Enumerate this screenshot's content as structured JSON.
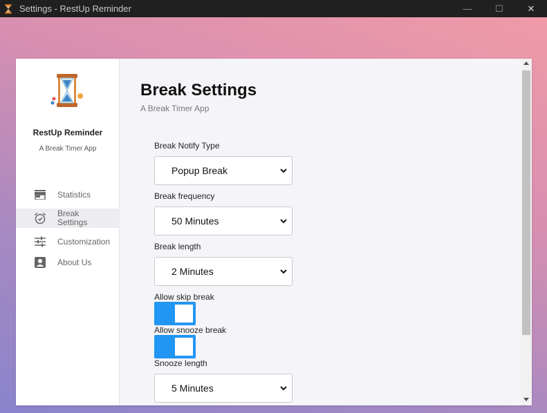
{
  "window": {
    "title": "Settings - RestUp Reminder",
    "minimize": "—",
    "maximize": "☐",
    "close": "✕"
  },
  "sidebar": {
    "app_name": "RestUp Reminder",
    "app_subtitle": "A Break Timer App",
    "items": [
      {
        "label": "Statistics",
        "icon": "store-icon",
        "active": false
      },
      {
        "label": "Break Settings",
        "icon": "alarm-clock-icon",
        "active": true
      },
      {
        "label": "Customization",
        "icon": "sliders-icon",
        "active": false
      },
      {
        "label": "About Us",
        "icon": "account-box-icon",
        "active": false
      }
    ]
  },
  "main": {
    "title": "Break Settings",
    "subtitle": "A Break Timer App",
    "fields": {
      "notify_type": {
        "label": "Break Notify Type",
        "value": "Popup Break"
      },
      "frequency": {
        "label": "Break frequency",
        "value": "50 Minutes"
      },
      "length": {
        "label": "Break length",
        "value": "2 Minutes"
      },
      "allow_skip": {
        "label": "Allow skip break",
        "enabled": true
      },
      "allow_snooze": {
        "label": "Allow snooze break",
        "enabled": true
      },
      "snooze_length": {
        "label": "Snooze length",
        "value": "5 Minutes"
      }
    }
  },
  "colors": {
    "accent": "#2196f3",
    "titlebar": "#202020",
    "background_gradient": [
      "#f09aa8",
      "#8a84cc"
    ]
  }
}
